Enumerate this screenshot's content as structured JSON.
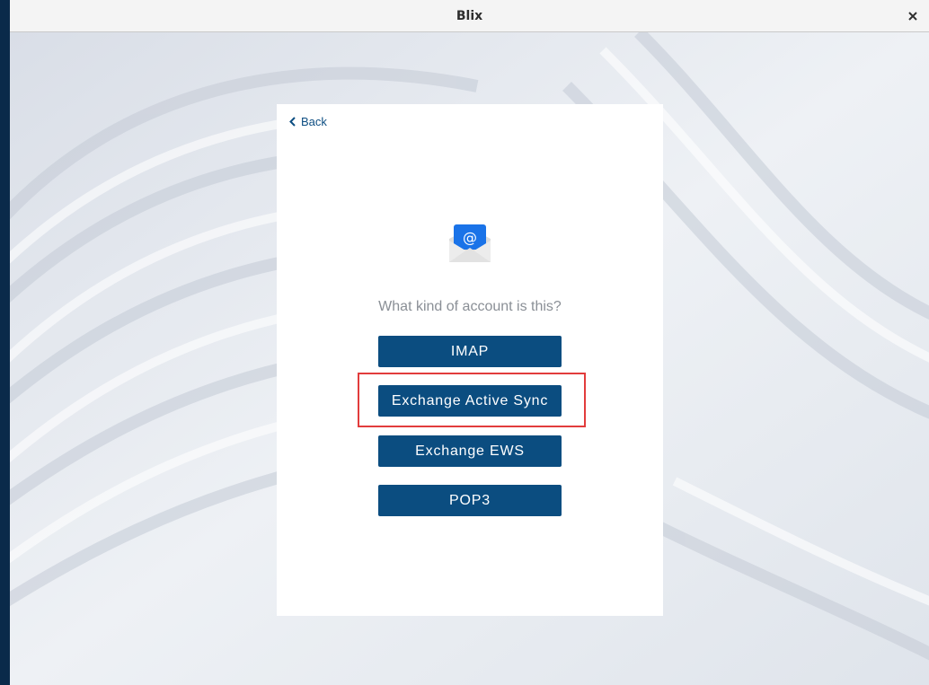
{
  "window": {
    "title": "Blix"
  },
  "setup": {
    "back_label": "Back",
    "question": "What kind of account is this?",
    "options": [
      "IMAP",
      "Exchange Active Sync",
      "Exchange EWS",
      "POP3"
    ]
  },
  "colors": {
    "primary": "#0b4d80",
    "highlight": "#e23c3c",
    "icon_blue": "#1a73e8"
  }
}
